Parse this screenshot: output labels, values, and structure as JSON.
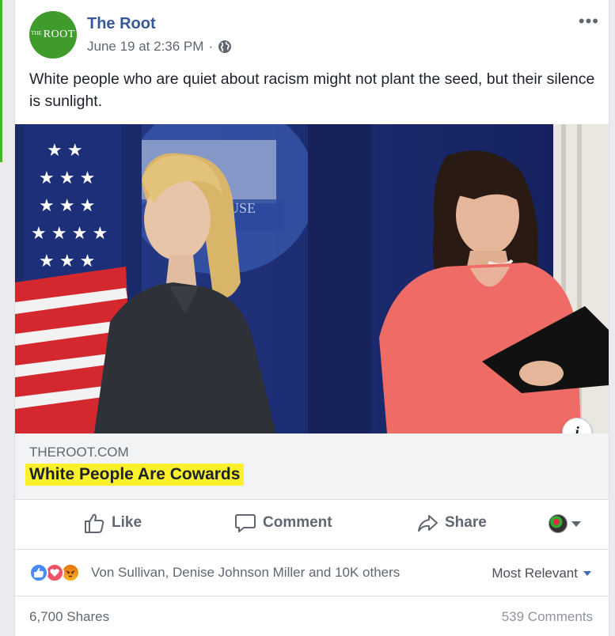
{
  "post": {
    "page_name": "The Root",
    "avatar_text_small": "THE",
    "avatar_text_big": "ROOT",
    "timestamp": "June 19 at 2:36 PM",
    "separator": "·",
    "privacy_icon": "globe-icon",
    "more_label": "•••",
    "text": "White people who are quiet about racism might not plant the seed, but their silence is sunlight.",
    "photo": {
      "description_icon": "news-photo",
      "background_text": "USE",
      "info_label": "i"
    },
    "link": {
      "domain": "THEROOT.COM",
      "title": "White People Are Cowards"
    }
  },
  "actions": {
    "like_label": "Like",
    "comment_label": "Comment",
    "share_label": "Share"
  },
  "reactions": {
    "icons": [
      "like-icon",
      "love-icon",
      "angry-icon"
    ],
    "names_text": "Von Sullivan, Denise Johnson Miller and 10K others",
    "sort_label": "Most Relevant"
  },
  "counts": {
    "shares": "6,700 Shares",
    "comments": "539 Comments"
  },
  "colors": {
    "brand_green": "#3f9b2c",
    "link_blue": "#365899",
    "highlight_yellow": "#fbf12b",
    "like_blue": "#4a8af4",
    "love_red": "#f25268"
  }
}
